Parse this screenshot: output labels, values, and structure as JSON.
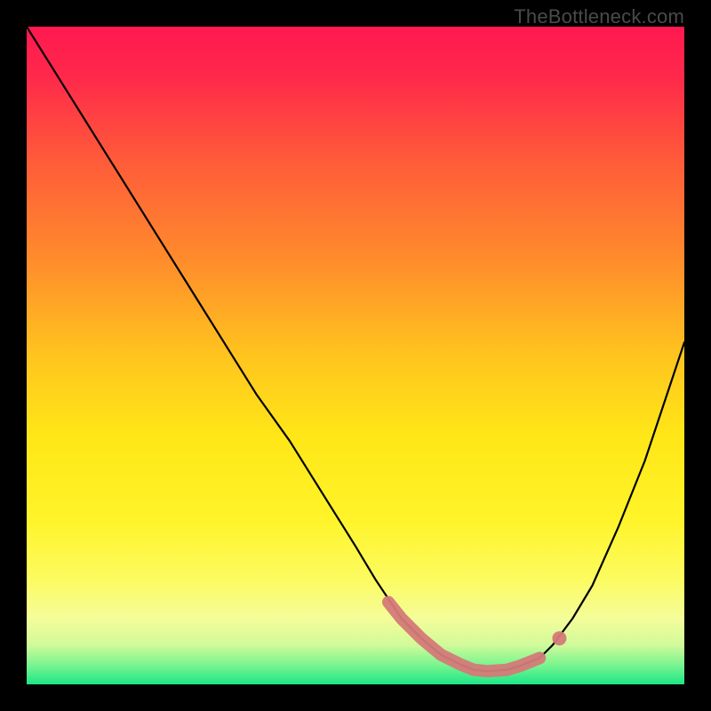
{
  "watermark": "TheBottleneck.com",
  "chart_data": {
    "type": "line",
    "title": "",
    "xlabel": "",
    "ylabel": "",
    "xlim": [
      0,
      100
    ],
    "ylim": [
      0,
      100
    ],
    "background_gradient": [
      {
        "stop": 0.0,
        "color": "#ff1850"
      },
      {
        "stop": 0.08,
        "color": "#ff2a4a"
      },
      {
        "stop": 0.2,
        "color": "#ff5a3a"
      },
      {
        "stop": 0.35,
        "color": "#ff8a2c"
      },
      {
        "stop": 0.5,
        "color": "#ffc41e"
      },
      {
        "stop": 0.62,
        "color": "#ffe617"
      },
      {
        "stop": 0.75,
        "color": "#fff42a"
      },
      {
        "stop": 0.84,
        "color": "#fcfb60"
      },
      {
        "stop": 0.9,
        "color": "#f4fd9a"
      },
      {
        "stop": 0.94,
        "color": "#d2fa9a"
      },
      {
        "stop": 0.97,
        "color": "#7bf590"
      },
      {
        "stop": 1.0,
        "color": "#1ee687"
      }
    ],
    "series": [
      {
        "name": "bottleneck-curve",
        "x": [
          0,
          5,
          10,
          15,
          20,
          25,
          30,
          35,
          40,
          45,
          50,
          53,
          55,
          57,
          60,
          63,
          66,
          68,
          70,
          73,
          75,
          78,
          80,
          83,
          86,
          90,
          94,
          98,
          100
        ],
        "values": [
          100,
          92,
          84,
          76,
          68,
          60,
          52,
          44,
          37,
          29,
          21,
          16,
          13,
          10,
          7,
          4.5,
          3,
          2.2,
          2,
          2.2,
          2.8,
          4,
          6,
          10,
          15,
          24,
          34,
          46,
          52
        ]
      }
    ],
    "highlight": {
      "name": "optimal-range",
      "color": "#d47a78",
      "x": [
        55,
        57,
        60,
        63,
        66,
        68,
        70,
        73,
        75,
        78
      ],
      "values": [
        12.5,
        10,
        7,
        4.5,
        3,
        2.2,
        2,
        2.2,
        2.8,
        4
      ]
    },
    "highlight_dot": {
      "x": 81,
      "y": 7,
      "color": "#d47a78"
    }
  }
}
